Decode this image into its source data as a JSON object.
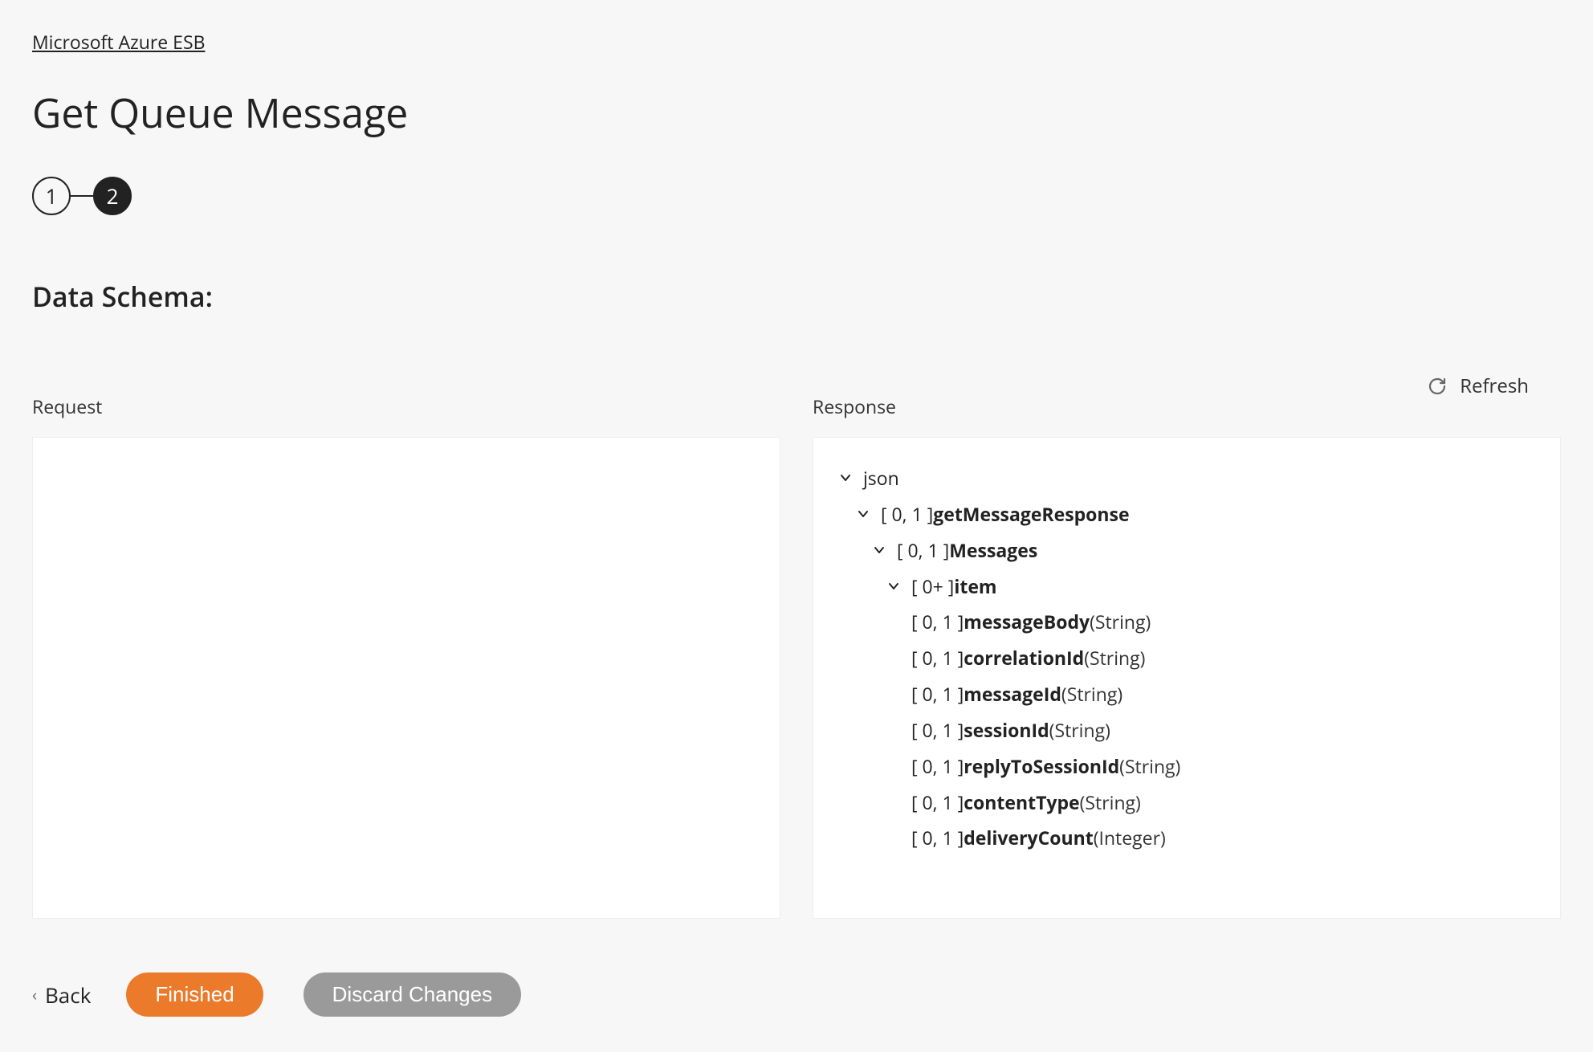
{
  "breadcrumb": "Microsoft Azure ESB",
  "page_title": "Get Queue Message",
  "stepper": {
    "steps": [
      "1",
      "2"
    ],
    "active_index": 1
  },
  "section_heading": "Data Schema:",
  "refresh_label": "Refresh",
  "panels": {
    "request_label": "Request",
    "response_label": "Response"
  },
  "response_tree": {
    "root": "json",
    "n0_card": "[ 0, 1 ] ",
    "n0_name": "getMessageResponse",
    "n1_card": "[ 0, 1 ] ",
    "n1_name": "Messages",
    "n2_card": "[ 0+ ] ",
    "n2_name": "item",
    "leaves": [
      {
        "card": "[ 0, 1 ] ",
        "name": "messageBody",
        "type": " (String)"
      },
      {
        "card": "[ 0, 1 ] ",
        "name": "correlationId",
        "type": " (String)"
      },
      {
        "card": "[ 0, 1 ] ",
        "name": "messageId",
        "type": " (String)"
      },
      {
        "card": "[ 0, 1 ] ",
        "name": "sessionId",
        "type": " (String)"
      },
      {
        "card": "[ 0, 1 ] ",
        "name": "replyToSessionId",
        "type": " (String)"
      },
      {
        "card": "[ 0, 1 ] ",
        "name": "contentType",
        "type": " (String)"
      },
      {
        "card": "[ 0, 1 ] ",
        "name": "deliveryCount",
        "type": " (Integer)"
      }
    ]
  },
  "footer": {
    "back": "Back",
    "finished": "Finished",
    "discard": "Discard Changes"
  }
}
